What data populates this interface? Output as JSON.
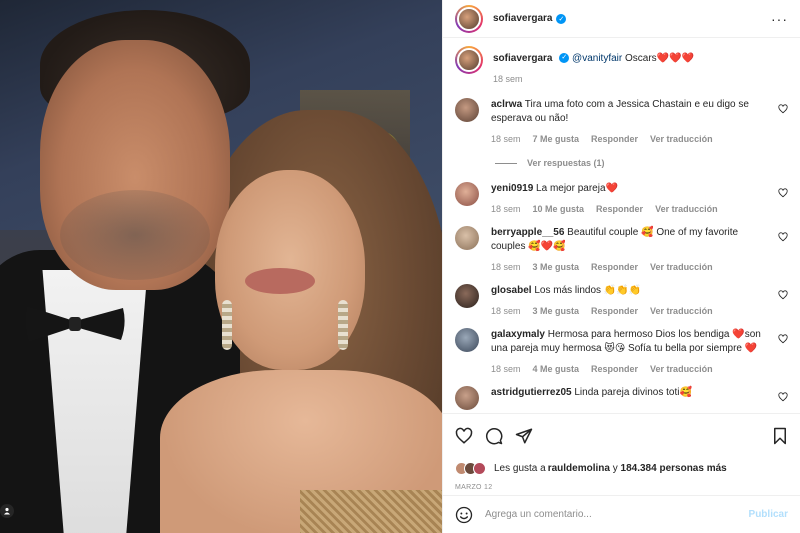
{
  "post": {
    "author": "sofiavergara",
    "verified": true
  },
  "caption": {
    "username": "sofiavergara",
    "mention": "@vanityfair",
    "text": " Oscars",
    "emoji": "❤️❤️❤️",
    "time": "18 sem"
  },
  "comments": [
    {
      "username": "aclrwa",
      "text": "Tira uma foto com a Jessica Chastain e eu digo se esperava ou não!",
      "time": "18 sem",
      "likes": "7 Me gusta",
      "reply": "Responder",
      "translate": "Ver traducción",
      "replies": "Ver respuestas (1)"
    },
    {
      "username": "yeni0919",
      "text": "La mejor pareja",
      "emoji": "❤️",
      "time": "18 sem",
      "likes": "10 Me gusta",
      "reply": "Responder",
      "translate": "Ver traducción"
    },
    {
      "username": "berryapple__56",
      "text": "Beautiful couple 🥰 One of my favorite couples 🥰❤️🥰",
      "time": "18 sem",
      "likes": "3 Me gusta",
      "reply": "Responder",
      "translate": "Ver traducción"
    },
    {
      "username": "glosabel",
      "text": "Los más lindos 👏👏👏",
      "time": "18 sem",
      "likes": "3 Me gusta",
      "reply": "Responder",
      "translate": "Ver traducción"
    },
    {
      "username": "galaxymaly",
      "text": "Hermosa para hermoso Dios los bendiga ❤️son una pareja muy hermosa 😻😘 Sofía tu bella por siempre ❤️",
      "time": "18 sem",
      "likes": "4 Me gusta",
      "reply": "Responder",
      "translate": "Ver traducción"
    },
    {
      "username": "astridgutierrez05",
      "text": "Linda pareja divinos toti🥰",
      "time": "",
      "likes": "",
      "reply": "",
      "translate": ""
    }
  ],
  "likes": {
    "prefix": "Les gusta a ",
    "user": "rauldemolina",
    "middle": " y ",
    "count": "184.384 personas más"
  },
  "date": "MARZO 12",
  "add_comment": {
    "placeholder": "Agrega un comentario...",
    "publish": "Publicar"
  },
  "icons": {
    "emoji": "smiley-icon",
    "like": "heart-icon",
    "comment": "comment-icon",
    "share": "paper-plane-icon",
    "save": "bookmark-icon",
    "more": "more-options-icon"
  },
  "colors": {
    "verified": "#0095f6",
    "publish_disabled": "#b2dffc",
    "heart": "#ed1c3b",
    "meta_text": "#8e8e8e"
  }
}
